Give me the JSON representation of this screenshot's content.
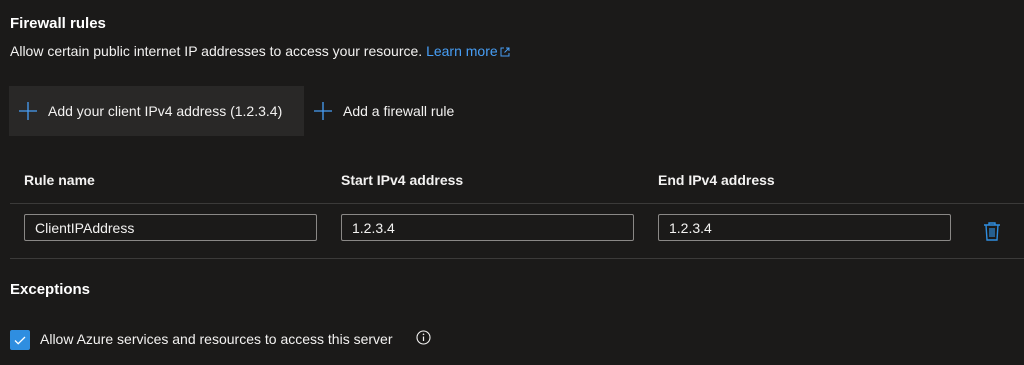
{
  "firewall": {
    "title": "Firewall rules",
    "description": "Allow certain public internet IP addresses to access your resource.",
    "learn_more": "Learn more",
    "add_client_label": "Add your client IPv4 address (1.2.3.4)",
    "add_rule_label": "Add a firewall rule"
  },
  "table": {
    "columns": [
      "Rule name",
      "Start IPv4 address",
      "End IPv4 address"
    ],
    "rows": [
      {
        "rule_name": "ClientIPAddress",
        "start_ip": "1.2.3.4",
        "end_ip": "1.2.3.4"
      }
    ]
  },
  "exceptions": {
    "title": "Exceptions",
    "allow_azure_label": "Allow Azure services and resources to access this server",
    "allow_azure_checked": true
  },
  "icons": {
    "add": "plus-icon",
    "delete": "trash-icon",
    "info": "info-icon",
    "external_link": "external-link-icon",
    "check": "checkmark-icon"
  },
  "colors": {
    "background": "#1b1a19",
    "accent": "#2f8ee0",
    "link": "#479ef5"
  }
}
